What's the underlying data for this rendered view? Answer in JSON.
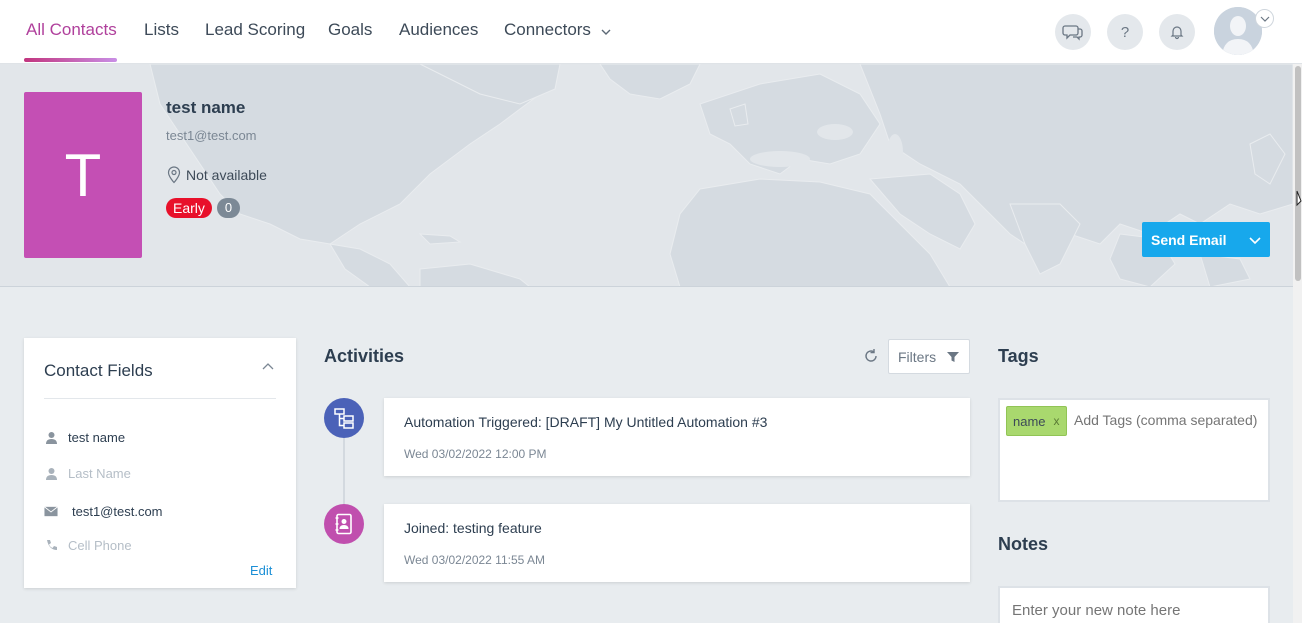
{
  "nav": {
    "items": [
      {
        "label": "All Contacts",
        "active": true
      },
      {
        "label": "Lists"
      },
      {
        "label": "Lead Scoring"
      },
      {
        "label": "Goals"
      },
      {
        "label": "Audiences"
      },
      {
        "label": "Connectors"
      }
    ],
    "icons": [
      "chat-icon",
      "help-icon",
      "bell-icon"
    ],
    "help_label": "?"
  },
  "contact": {
    "initial": "T",
    "name": "test name",
    "email": "test1@test.com",
    "location": "Not available",
    "stage_badge": "Early",
    "score": "0",
    "avatar_color": "#c44fb4"
  },
  "actions": {
    "send_email": "Send Email"
  },
  "contact_fields": {
    "title": "Contact Fields",
    "rows": [
      {
        "icon": "person-icon",
        "value": "test name",
        "placeholder": false
      },
      {
        "icon": "person-icon",
        "value": "Last Name",
        "placeholder": true
      },
      {
        "icon": "envelope-icon",
        "value": "test1@test.com",
        "placeholder": false
      },
      {
        "icon": "phone-icon",
        "value": "Cell Phone",
        "placeholder": true
      }
    ],
    "edit": "Edit"
  },
  "activities": {
    "title": "Activities",
    "filters": "Filters",
    "items": [
      {
        "text": "Automation Triggered: [DRAFT] My Untitled Automation #3",
        "date": "Wed 03/02/2022 12:00 PM",
        "icon": "automation-icon",
        "color": "#4b62b8"
      },
      {
        "text": "Joined: testing feature",
        "date": "Wed 03/02/2022 11:55 AM",
        "icon": "contact-book-icon",
        "color": "#c04fae"
      }
    ]
  },
  "tags": {
    "title": "Tags",
    "chips": [
      {
        "label": "name",
        "remove": "x"
      }
    ],
    "input_placeholder": "Add Tags (comma separated)"
  },
  "notes": {
    "title": "Notes",
    "input_placeholder": "Enter your new note here"
  },
  "colors": {
    "accent": "#b0409c",
    "primary_button": "#17a8ec",
    "badge_early": "#e8102a",
    "tag_chip": "#a9d86e"
  }
}
